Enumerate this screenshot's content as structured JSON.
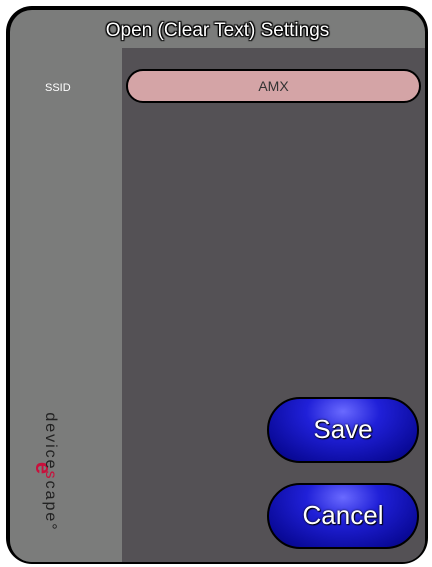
{
  "header": {
    "title": "Open (Clear Text) Settings"
  },
  "form": {
    "ssid_label": "SSID",
    "ssid_value": "AMX"
  },
  "actions": {
    "save_label": "Save",
    "cancel_label": "Cancel"
  },
  "branding": {
    "logo_glyph": "e",
    "text_before": "device",
    "text_accent": "s",
    "text_after": "cape",
    "trademark": "°",
    "accent_color": "#c8103c"
  },
  "colors": {
    "panel": "#7b7c7b",
    "content": "#545155",
    "field": "#d4a4a6",
    "button": "#2020d8"
  }
}
